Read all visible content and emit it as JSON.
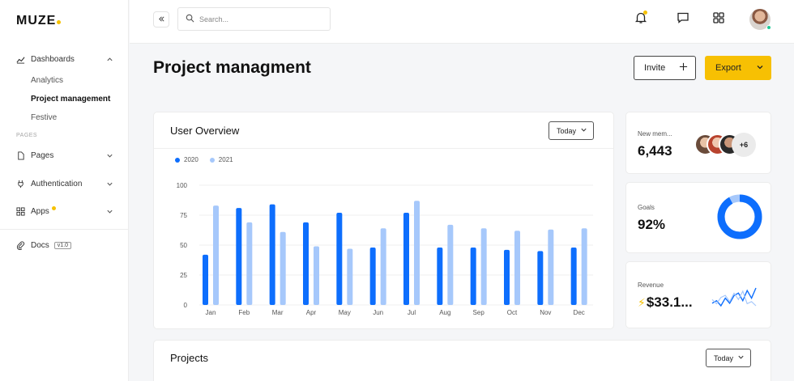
{
  "brand": {
    "name": "MUZE",
    "accent": "#f6c100"
  },
  "sidebar": {
    "dashboards_label": "Dashboards",
    "sub_items": [
      "Analytics",
      "Project management",
      "Festive"
    ],
    "section_label": "PAGES",
    "pages_label": "Pages",
    "auth_label": "Authentication",
    "apps_label": "Apps",
    "docs_label": "Docs",
    "docs_version": "v1.0"
  },
  "topbar": {
    "search_placeholder": "Search...",
    "icons": [
      "bell-icon",
      "chat-icon",
      "grid-icon"
    ]
  },
  "page": {
    "title": "Project managment",
    "invite_label": "Invite",
    "export_label": "Export"
  },
  "overview": {
    "title": "User Overview",
    "filter": "Today"
  },
  "stats": {
    "members_label": "New mem...",
    "members_value": "6,443",
    "members_more": "+6",
    "goals_label": "Goals",
    "goals_value": "92%",
    "goals_percent": 92,
    "revenue_label": "Revenue",
    "revenue_value": "$33.1...",
    "revenue_trend": [
      6,
      7,
      5,
      8,
      6,
      9,
      10,
      7,
      11,
      8,
      12
    ]
  },
  "projects": {
    "title": "Projects",
    "filter": "Today"
  },
  "chart_data": {
    "type": "bar",
    "categories": [
      "Jan",
      "Feb",
      "Mar",
      "Apr",
      "May",
      "Jun",
      "Jul",
      "Aug",
      "Sep",
      "Oct",
      "Nov",
      "Dec"
    ],
    "series": [
      {
        "name": "2020",
        "color": "#0d6efd",
        "values": [
          42,
          81,
          84,
          69,
          77,
          48,
          77,
          48,
          48,
          46,
          45,
          48
        ]
      },
      {
        "name": "2021",
        "color": "#a6c8fb",
        "values": [
          83,
          69,
          61,
          49,
          47,
          64,
          87,
          67,
          64,
          62,
          63,
          64
        ]
      }
    ],
    "yticks": [
      0,
      25,
      50,
      75,
      100
    ],
    "ylim": [
      0,
      100
    ],
    "grid": true,
    "legend": "top-left"
  }
}
